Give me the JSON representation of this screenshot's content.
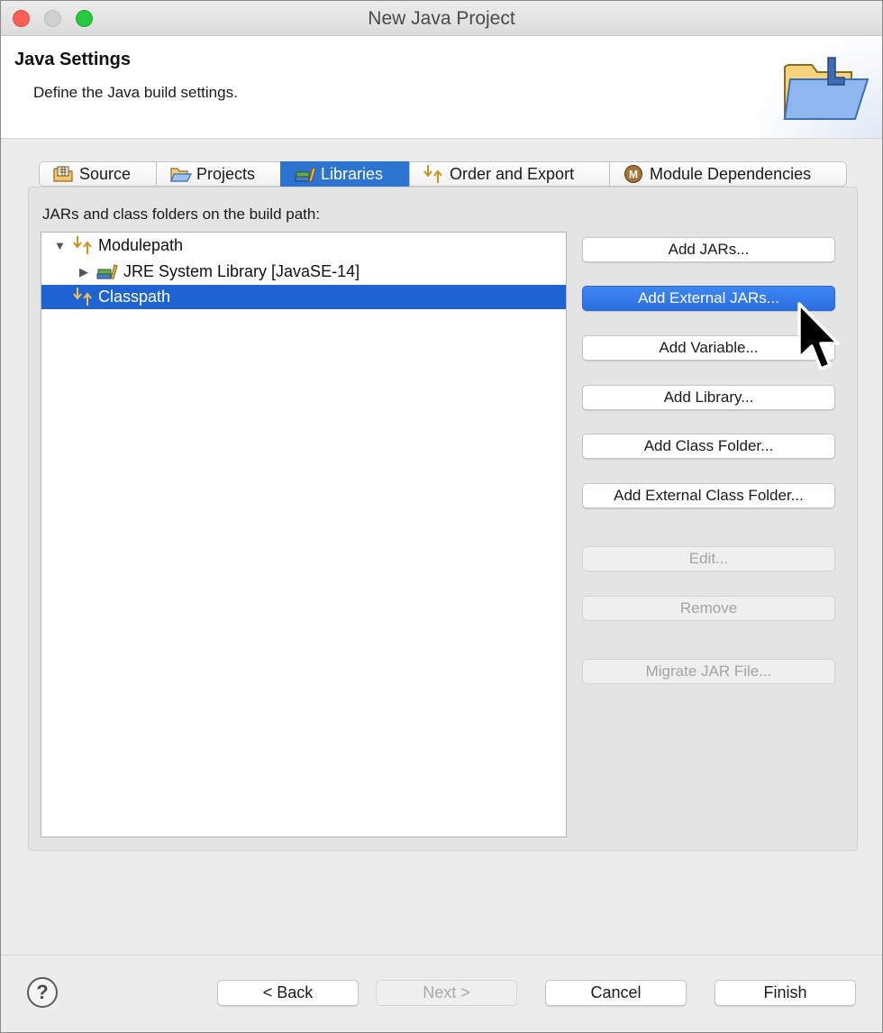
{
  "window": {
    "title": "New Java Project"
  },
  "header": {
    "title": "Java Settings",
    "description": "Define the Java build settings."
  },
  "tabs": [
    {
      "label": "Source",
      "icon": "source-folder-icon",
      "active": false
    },
    {
      "label": "Projects",
      "icon": "projects-folder-icon",
      "active": false
    },
    {
      "label": "Libraries",
      "icon": "libraries-icon",
      "active": true
    },
    {
      "label": "Order and Export",
      "icon": "order-export-icon",
      "active": false
    },
    {
      "label": "Module Dependencies",
      "icon": "module-icon",
      "active": false
    }
  ],
  "libraries": {
    "label": "JARs and class folders on the build path:",
    "tree": [
      {
        "label": "Modulepath",
        "icon": "modulepath-icon",
        "expanded": true,
        "selected": false
      },
      {
        "label": "JRE System Library [JavaSE-14]",
        "icon": "library-icon",
        "expanded": false,
        "selected": false
      },
      {
        "label": "Classpath",
        "icon": "classpath-icon",
        "selected": true
      }
    ],
    "buttons": {
      "add_jars": "Add JARs...",
      "add_external_jars": "Add External JARs...",
      "add_variable": "Add Variable...",
      "add_library": "Add Library...",
      "add_class_folder": "Add Class Folder...",
      "add_external_class_folder": "Add External Class Folder...",
      "edit": "Edit...",
      "remove": "Remove",
      "migrate_jar": "Migrate JAR File..."
    }
  },
  "footer": {
    "help": "?",
    "back": "< Back",
    "next": "Next >",
    "cancel": "Cancel",
    "finish": "Finish"
  },
  "colors": {
    "accent": "#2c73d2",
    "selection": "#1f63d3",
    "close": "#fd5f57",
    "maximize": "#28c840"
  }
}
